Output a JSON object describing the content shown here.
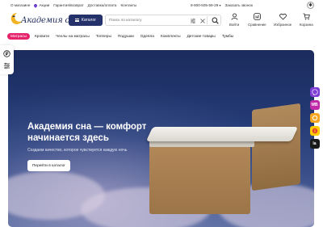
{
  "topbar": {
    "links": [
      "О магазине",
      "Акции",
      "Гарантия/возврат",
      "Доставка/оплата",
      "Контакты"
    ],
    "phone": "8-800-505-59-29",
    "callback": "Заказать звонок"
  },
  "brand": {
    "name": "Академия сна"
  },
  "header": {
    "catalog_label": "Каталог",
    "search_placeholder": "Поиск по каталогу",
    "actions": [
      {
        "label": "Войти",
        "icon": "user-icon"
      },
      {
        "label": "Сравнение",
        "icon": "compare-icon"
      },
      {
        "label": "Избранное",
        "icon": "heart-icon"
      },
      {
        "label": "Корзина",
        "icon": "cart-icon"
      }
    ]
  },
  "nav": {
    "highlight": "Матрасы",
    "items": [
      "Кровати",
      "Чехлы на матрасы",
      "Топперы",
      "Подушки",
      "Одеяла",
      "Комплекты",
      "Детские товары",
      "Тумбы"
    ]
  },
  "hero": {
    "title": "Академия сна — комфорт начинается здесь",
    "subtitle": "Создаем качество, которое чувствуется каждую ночь",
    "cta": "Перейти в каталог"
  },
  "badges": [
    {
      "icon": "viber-icon",
      "color": "#7d3dd6"
    },
    {
      "icon": "wildberries-icon",
      "color": "#c02aa8",
      "text": "WB"
    },
    {
      "icon": "ozon-icon",
      "color": "#f5a623"
    },
    {
      "icon": "yandex-market-icon",
      "color": "#ffcc00"
    },
    {
      "icon": "lamoda-icon",
      "color": "#1a1a1a",
      "text": "la"
    }
  ],
  "colors": {
    "accent": "#24316b",
    "highlight": "#e6226b"
  }
}
